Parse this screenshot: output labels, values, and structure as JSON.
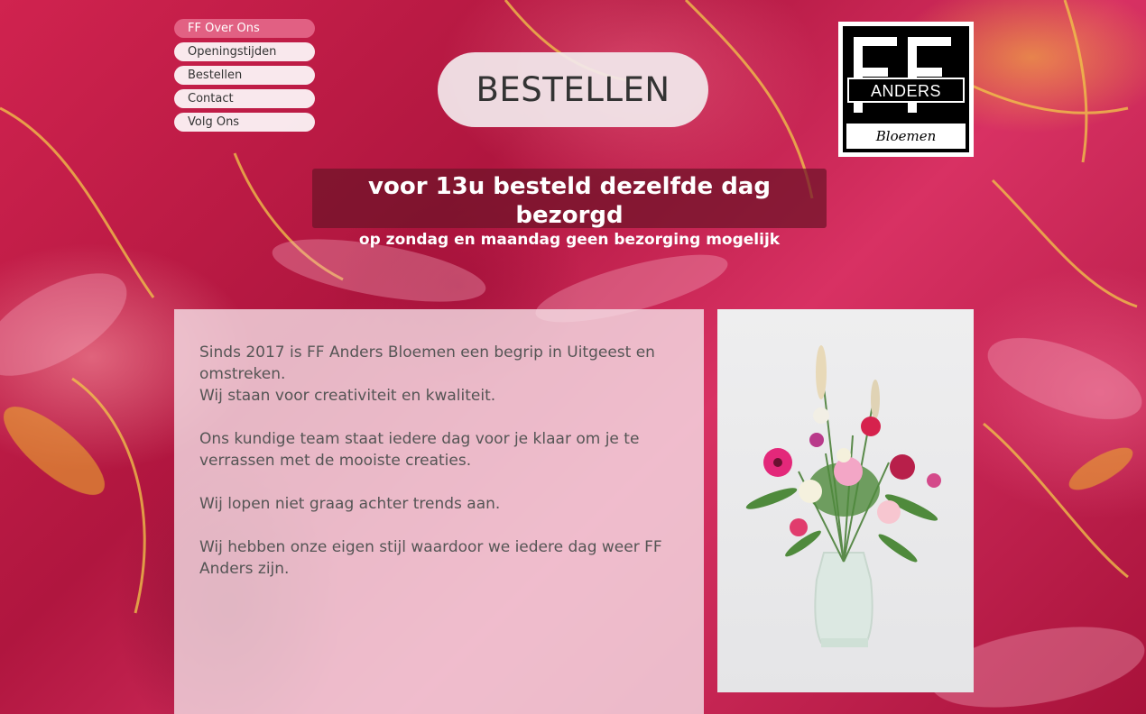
{
  "nav": {
    "items": [
      {
        "label": "FF Over Ons"
      },
      {
        "label": "Openingstijden"
      },
      {
        "label": "Bestellen"
      },
      {
        "label": "Contact"
      },
      {
        "label": "Volg Ons"
      }
    ]
  },
  "header": {
    "bestellen_label": "BESTELLEN"
  },
  "logo": {
    "line1": "FF",
    "line2": "ANDERS",
    "line3": "Bloemen"
  },
  "banner": {
    "line1": "voor 13u besteld dezelfde dag bezorgd",
    "line2": "op zondag en maandag geen bezorging mogelijk"
  },
  "about": {
    "p1a": "Sinds 2017 is FF Anders Bloemen een begrip in Uitgeest en omstreken.",
    "p1b": "Wij staan voor creativiteit en kwaliteit.",
    "p2": "Ons kundige team staat iedere dag voor je klaar om je te verrassen met de mooiste creaties.",
    "p3": "Wij lopen niet graag achter trends aan.",
    "p4": "Wij hebben onze eigen stijl waardoor we iedere dag weer FF Anders zijn."
  },
  "colors": {
    "accent": "#e4688a",
    "banner_bg": "#6e1428",
    "background": "#c8204e"
  }
}
